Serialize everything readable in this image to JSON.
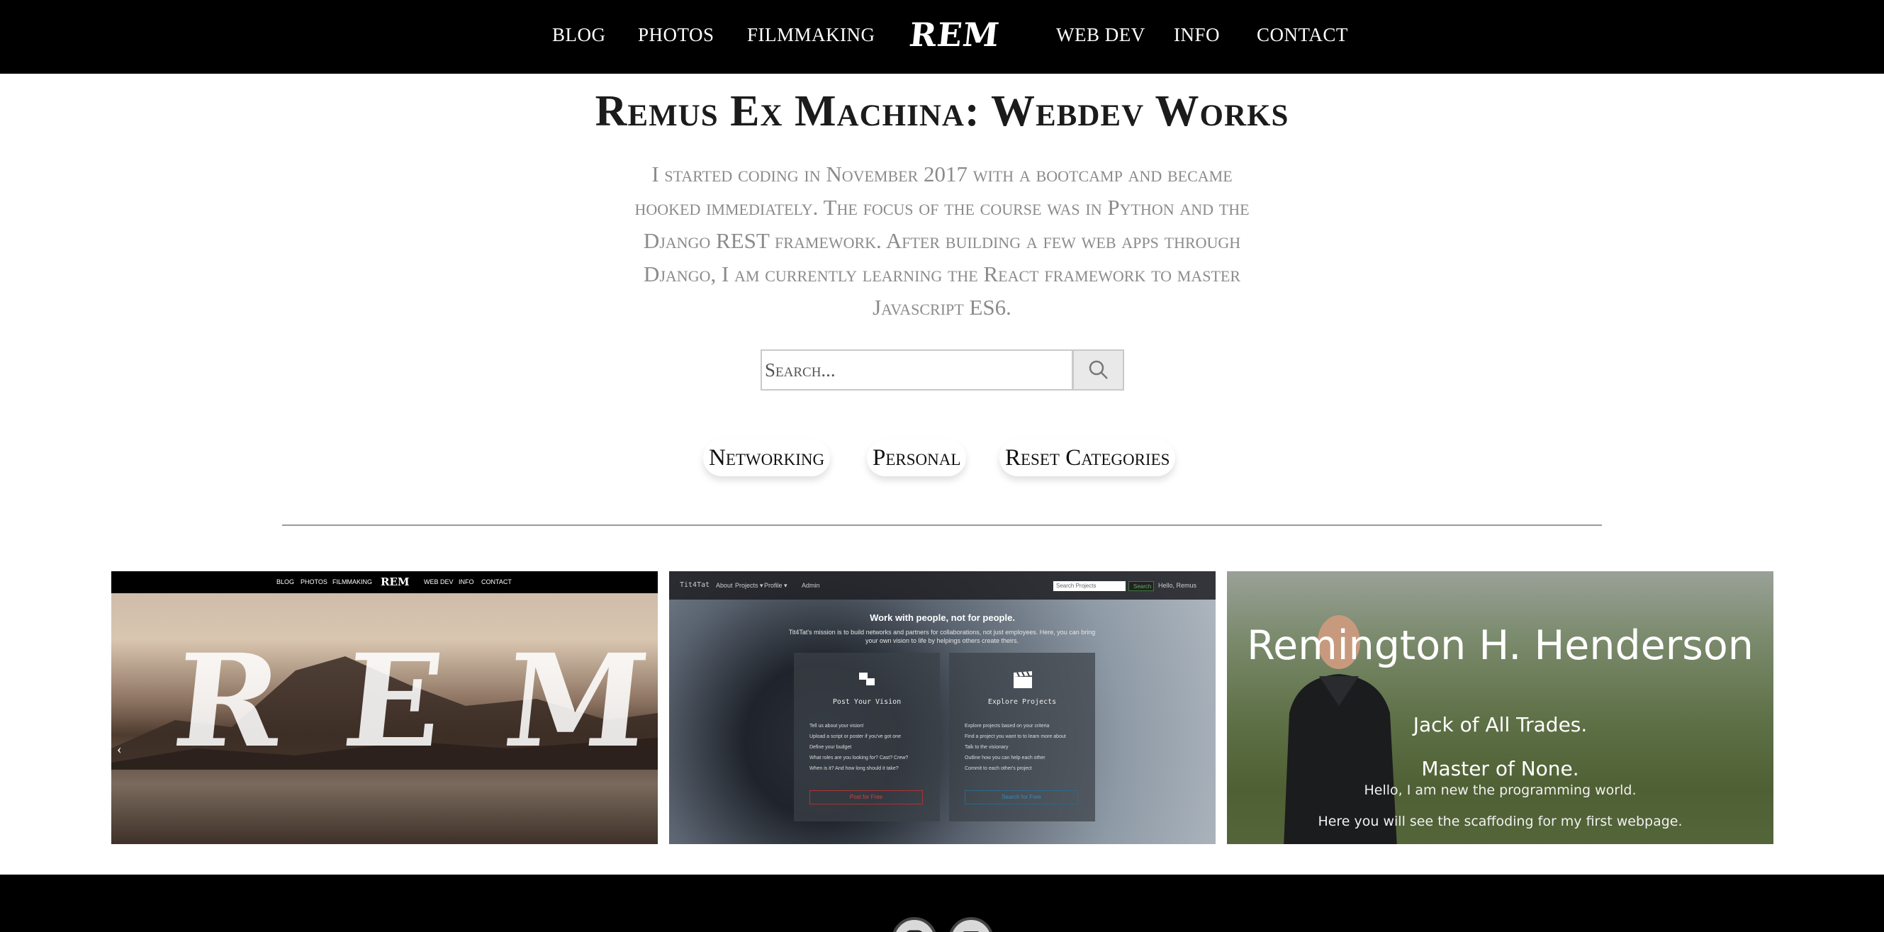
{
  "nav": {
    "left_items": [
      "BLOG",
      "PHOTOS",
      "FILMMAKING"
    ],
    "logo": "REM",
    "right_items": [
      "WEB DEV",
      "INFO",
      "CONTACT"
    ]
  },
  "header": {
    "title": "Remus Ex Machina: Webdev Works",
    "intro": "I started coding in November 2017 with a bootcamp and became hooked immediately. The focus of the course was in Python and the Django REST framework. After building a few web apps through Django, I am currently learning the React framework to master Javascript ES6."
  },
  "search": {
    "placeholder": "Search..."
  },
  "categories": [
    "Networking",
    "Personal",
    "Reset Categories"
  ],
  "cards": [
    {
      "mini_nav": [
        "BLOG",
        "PHOTOS",
        "FILMMAKING",
        "REM",
        "WEB DEV",
        "INFO",
        "CONTACT"
      ],
      "overlay": "REM",
      "arrow": "‹"
    },
    {
      "brand": "Tit4Tat",
      "links": [
        "About",
        "Projects ▾",
        "Profile ▾",
        "Admin"
      ],
      "search_placeholder": "Search Projects",
      "search_button": "Search",
      "hello": "Hello, Remus",
      "headline": "Work with people, not for people.",
      "sub": "Tit4Tat's mission is to build networks and partners for collaborations, not just employees. Here, you can bring your own vision to life by helpings others create theirs.",
      "panel_left": {
        "title": "Post Your Vision",
        "items": [
          "Tell us about your vision!",
          "Upload a script or poster if you've got one",
          "Define your budget",
          "What roles are you looking for? Cast? Crew?",
          "When is it? And how long should it take?"
        ],
        "button": "Post for Free"
      },
      "panel_right": {
        "title": "Explore Projects",
        "items": [
          "Explore projects based on your criteria",
          "Find a project you want to to learn more about",
          "Talk to the visionary",
          "Outline how you can help each other",
          "Commit to each other's project"
        ],
        "button": "Search for Free"
      }
    },
    {
      "name": "Remington H. Henderson",
      "line1": "Jack of All Trades.",
      "line2": "Master of None.",
      "line3": "Hello, I am new the programming world.",
      "line4": "Here you will see the scaffoding for my first webpage."
    }
  ],
  "colors": {
    "nav_bg": "#000000",
    "intro_text": "#8b8b8b",
    "divider": "#9a9a9a"
  },
  "footer": {
    "icons": [
      "instagram-icon",
      "facebook-icon"
    ]
  }
}
